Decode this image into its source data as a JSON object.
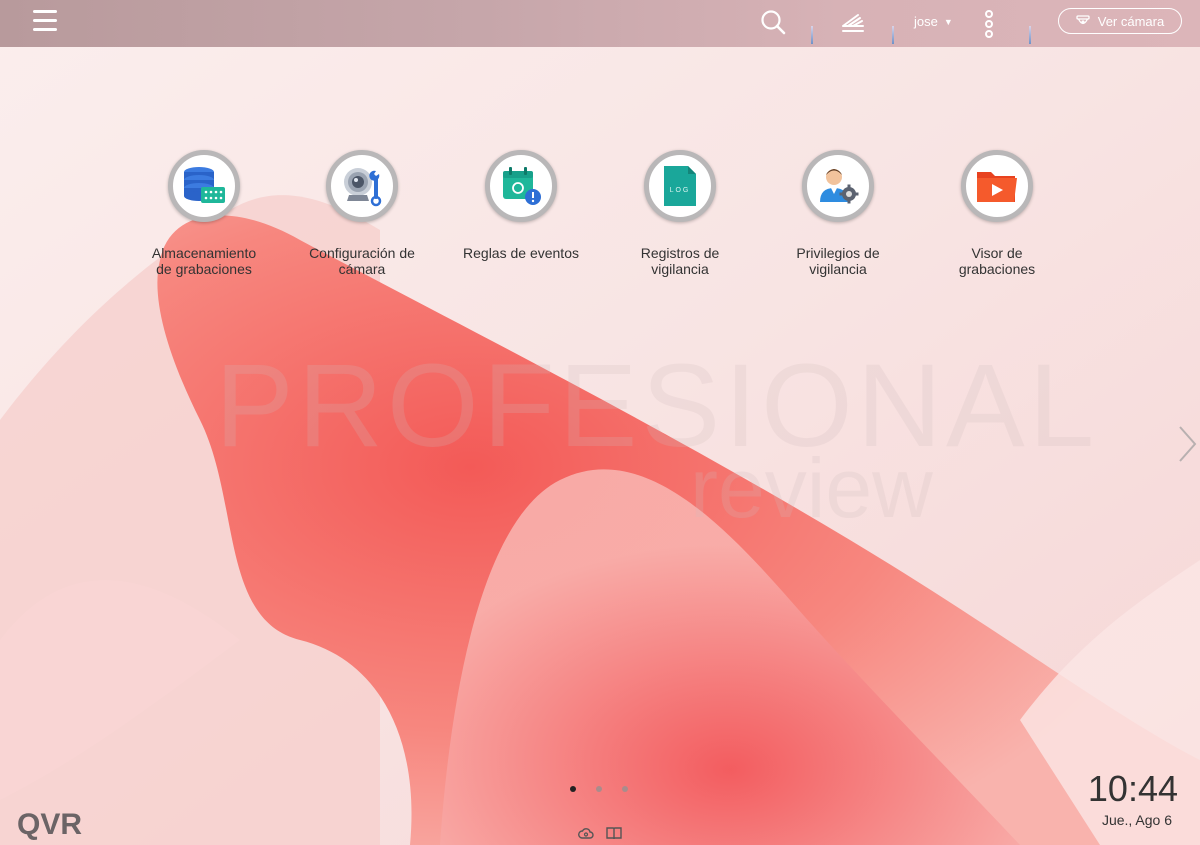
{
  "topbar": {
    "user": "jose",
    "view_camera_label": "Ver cámara"
  },
  "apps": [
    {
      "label_line1": "Almacenamiento",
      "label_line2": "de grabaciones",
      "icon": "storage-database-icon"
    },
    {
      "label_line1": "Configuración de",
      "label_line2": "cámara",
      "icon": "camera-settings-icon"
    },
    {
      "label_line1": "Reglas de eventos",
      "label_line2": "",
      "icon": "event-calendar-icon"
    },
    {
      "label_line1": "Registros de",
      "label_line2": "vigilancia",
      "icon": "log-file-icon"
    },
    {
      "label_line1": "Privilegios de",
      "label_line2": "vigilancia",
      "icon": "user-gear-icon"
    },
    {
      "label_line1": "Visor de",
      "label_line2": "grabaciones",
      "icon": "video-folder-icon"
    }
  ],
  "watermark": {
    "line1": "PROFESIONAL",
    "line2": "review"
  },
  "pager": {
    "pages": 3,
    "active": 1
  },
  "logo": "QVR",
  "clock": {
    "time": "10:44",
    "date": "Jue., Ago 6"
  },
  "colors": {
    "accent": "#f35a4a",
    "teal": "#1fb7a6",
    "blue": "#2a6fd6"
  }
}
